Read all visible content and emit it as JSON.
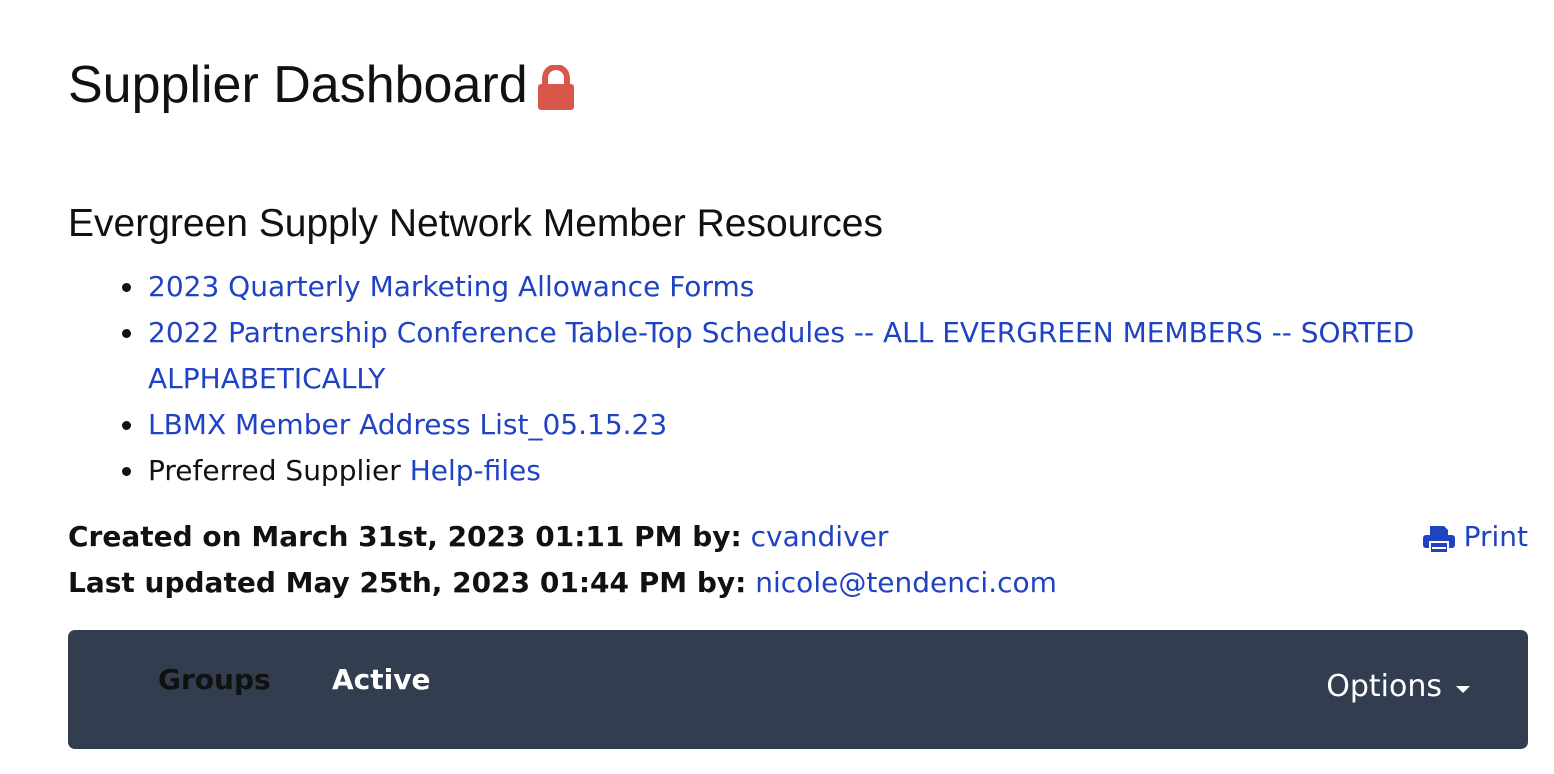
{
  "header": {
    "title": "Supplier Dashboard",
    "lock_icon": "lock-icon",
    "lock_color": "#d9574a"
  },
  "resources": {
    "title": "Evergreen Supply Network Member Resources",
    "items": [
      {
        "prefix": "",
        "link": "2023 Quarterly Marketing Allowance Forms"
      },
      {
        "prefix": "",
        "link": "2022 Partnership Conference Table-Top Schedules -- ALL EVERGREEN MEMBERS -- SORTED ALPHABETICALLY"
      },
      {
        "prefix": "",
        "link": "LBMX Member Address List_05.15.23"
      },
      {
        "prefix": "Preferred Supplier ",
        "link": "Help-files"
      }
    ]
  },
  "meta": {
    "created_label": "Created on March 31st, 2023 01:11 PM by:",
    "created_by": "cvandiver",
    "updated_label": "Last updated May 25th, 2023 01:44 PM by:",
    "updated_by": "nicole@tendenci.com",
    "print_label": "Print",
    "print_icon": "print-icon"
  },
  "navbar": {
    "tabs": [
      {
        "label": "Groups"
      },
      {
        "label": "Active"
      }
    ],
    "options_label": "Options",
    "background": "#323d4f"
  },
  "colors": {
    "link": "#1f43c2",
    "text": "#111111"
  }
}
